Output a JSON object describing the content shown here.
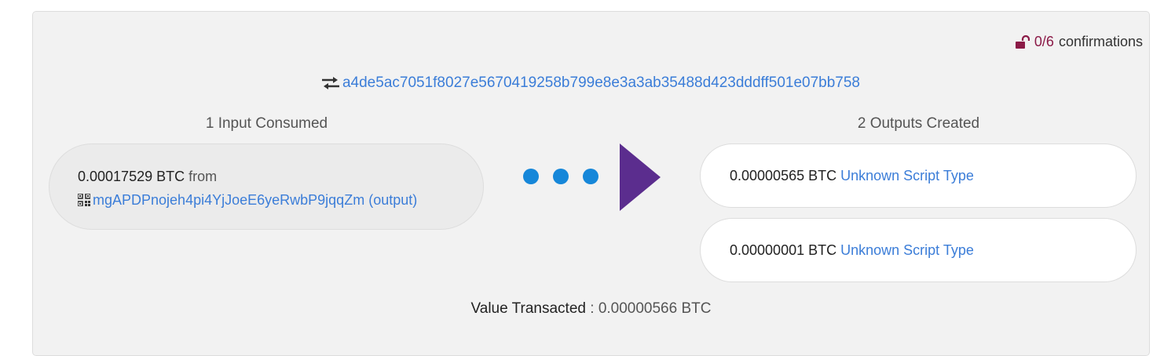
{
  "confirmations": {
    "count": "0/6",
    "label": "confirmations",
    "icon": "unlock-icon",
    "color": "#8b1a47"
  },
  "transaction": {
    "icon": "exchange-arrows-icon",
    "txid": "a4de5ac7051f8027e5670419258b799e8e3a3ab35488d423dddff501e07bb758"
  },
  "inputs": {
    "heading": "1 Input Consumed",
    "items": [
      {
        "amount": "0.00017529 BTC",
        "from_label": "from",
        "address_icon": "qr-code-icon",
        "address": "mgAPDPnojeh4pi4YjJoeE6yeRwbP9jqqZm",
        "output_link": "(output)"
      }
    ]
  },
  "outputs": {
    "heading": "2 Outputs Created",
    "items": [
      {
        "amount": "0.00000565 BTC",
        "script_type": "Unknown Script Type"
      },
      {
        "amount": "0.00000001 BTC",
        "script_type": "Unknown Script Type"
      }
    ]
  },
  "summary": {
    "label": "Value Transacted",
    "separator": ":",
    "value": "0.00000566 BTC"
  },
  "colors": {
    "link": "#3b7dd8",
    "dots": "#1687d9",
    "arrow": "#5b2d8e"
  }
}
